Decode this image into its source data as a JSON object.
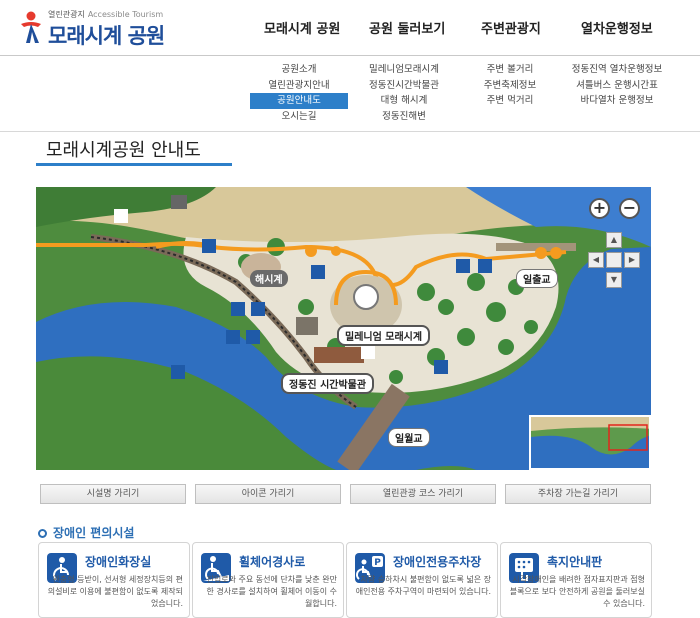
{
  "brand": {
    "tagline": "열린관광지",
    "tagline_en": "Accessible Tourism",
    "name": "모래시계 공원"
  },
  "nav": [
    {
      "label": "모래시계 공원"
    },
    {
      "label": "공원 둘러보기"
    },
    {
      "label": "주변관광지"
    },
    {
      "label": "열차운행정보"
    }
  ],
  "submenu": {
    "col1": [
      "공원소개",
      "열린관광지안내",
      "공원안내도",
      "오시는길"
    ],
    "col2": [
      "밀레니엄모래시계",
      "정동진시간박물관",
      "대형 해시계",
      "정동진해변"
    ],
    "col3": [
      "주변 볼거리",
      "주변축제정보",
      "주변 먹거리"
    ],
    "col4": [
      "정동진역 열차운행정보",
      "셔틀버스 운행시간표",
      "바다열차 운행정보"
    ]
  },
  "page_title": "모래시계공원 안내도",
  "map": {
    "labels": {
      "sundial": "해시계",
      "sandglass": "밀레니엄 모래시계",
      "museum": "정동진 시간박물관",
      "sunrise_bridge": "일출교",
      "moon_bridge": "일월교"
    },
    "colors": {
      "water": "#2f6fc0",
      "land": "#e8e3d4",
      "route": "#f49b1f",
      "forest": "#4e8c3e"
    }
  },
  "toggles": [
    "시설명 가리기",
    "아이콘 가리기",
    "열린관광 코스 가리기",
    "주차장 가는길 가리기"
  ],
  "facility_section": {
    "title": "장애인 편의시설",
    "cards": [
      {
        "icon": "accessible-toilet-icon",
        "title": "장애인화장실",
        "desc": "완충형 등받이, 선서형 세정장치등의 편의설비로 이용에 불편함이 없도록 제작되었습니다."
      },
      {
        "icon": "wheelchair-ramp-icon",
        "title": "휠체어경사로",
        "desc": "진입로와 주요 동선에 단차를 낮춘 완만한 경사로를 설치하여 휠체어 이동이 수월합니다."
      },
      {
        "icon": "accessible-parking-icon",
        "title": "장애인전용주차장",
        "desc": "차량 승하차시 불편함이 없도록 넓은 장애인전용 주차구역이 마련되어 있습니다."
      },
      {
        "icon": "tactile-map-icon",
        "title": "촉지안내판",
        "desc": "시각장애인을 배려한 점자표지판과 점형블록으로 보다 안전하게 공원을 둘러보실 수 있습니다."
      }
    ]
  }
}
